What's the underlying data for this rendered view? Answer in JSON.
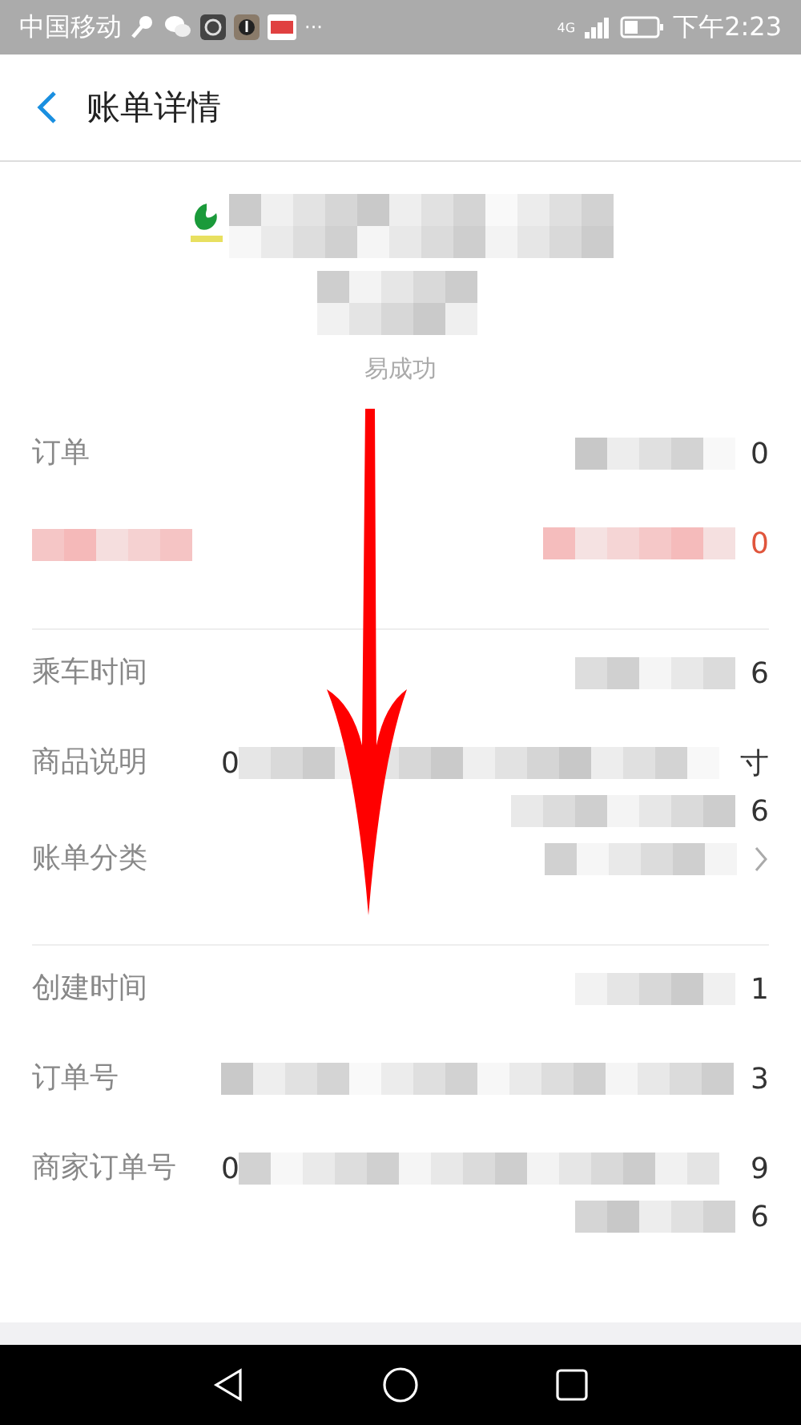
{
  "status_bar": {
    "carrier": "中国移动",
    "more": "···",
    "network": "4G",
    "time": "下午2:23"
  },
  "header": {
    "title": "账单详情"
  },
  "merchant": {
    "status": "易成功"
  },
  "sections": [
    {
      "rows": [
        {
          "kind": "plain",
          "label": "订单",
          "lines": [
            {
              "tail": "0"
            }
          ]
        },
        {
          "kind": "amount",
          "lines": [
            {
              "tail": "0"
            }
          ]
        }
      ]
    },
    {
      "rows": [
        {
          "kind": "plain",
          "label": "乘车时间",
          "lines": [
            {
              "tail": "6"
            }
          ]
        },
        {
          "kind": "plain",
          "label": "商品说明",
          "lines": [
            {
              "lead": "0",
              "wide": true,
              "tail": "寸"
            },
            {
              "tail": "6"
            }
          ]
        },
        {
          "kind": "link",
          "label": "账单分类"
        }
      ]
    },
    {
      "rows": [
        {
          "kind": "plain",
          "label": "创建时间",
          "lines": [
            {
              "tail": "1"
            }
          ]
        },
        {
          "kind": "plain",
          "label": "订单号",
          "lines": [
            {
              "wide": true,
              "tail": "3"
            }
          ]
        },
        {
          "kind": "plain",
          "label": "商家订单号",
          "lines": [
            {
              "lead": "0",
              "wide": true,
              "tail": "9"
            },
            {
              "tail": "6"
            }
          ]
        }
      ]
    }
  ]
}
